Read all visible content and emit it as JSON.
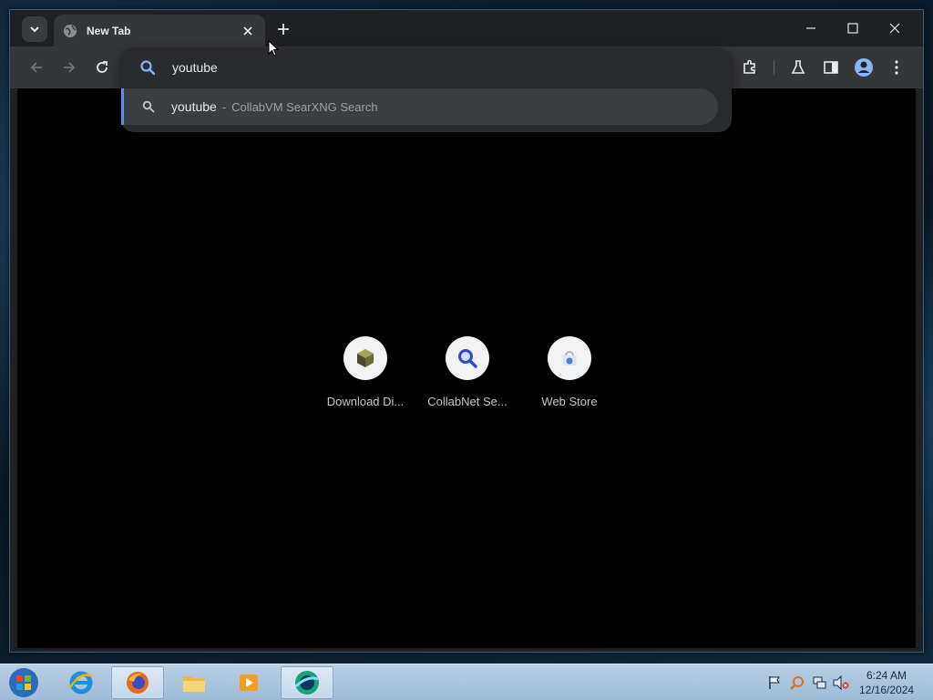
{
  "browser": {
    "tab": {
      "title": "New Tab"
    },
    "omnibox": {
      "query": "youtube",
      "suggestion": {
        "text": "youtube",
        "separator": "-",
        "description": "CollabVM SearXNG Search"
      }
    },
    "shortcuts": [
      {
        "label": "Download Di...",
        "icon": "3d-box-icon"
      },
      {
        "label": "CollabNet Se...",
        "icon": "magnifier-icon"
      },
      {
        "label": "Web Store",
        "icon": "web-store-icon"
      }
    ]
  },
  "taskbar": {
    "clock": {
      "time": "6:24 AM",
      "date": "12/16/2024"
    },
    "apps": [
      "internet-explorer-icon",
      "firefox-icon",
      "file-explorer-icon",
      "media-player-icon",
      "browser-icon"
    ]
  },
  "colors": {
    "accent": "#5b8def",
    "window_bg": "#1f2023",
    "toolbar_bg": "#35363a",
    "content_bg": "#000000"
  }
}
